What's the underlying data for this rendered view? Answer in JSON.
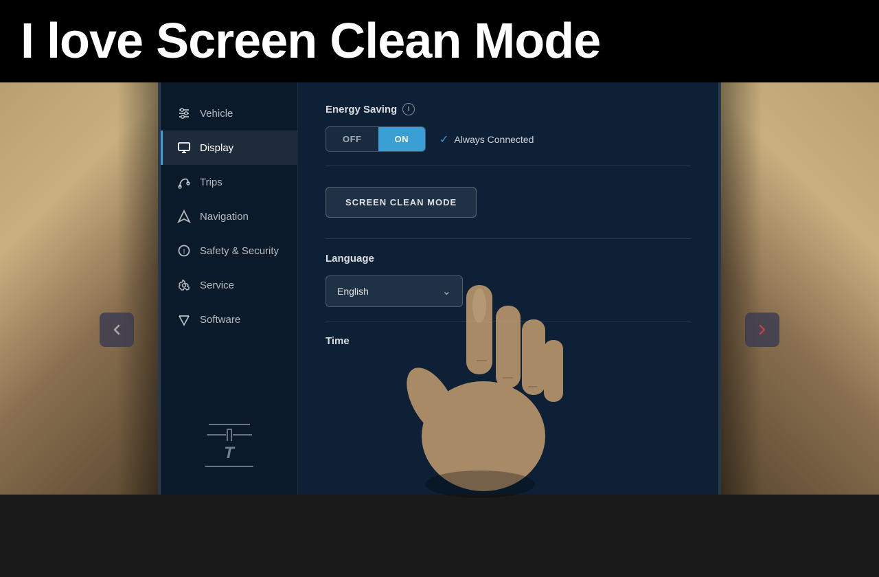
{
  "top_bar": {
    "title": "I love Screen Clean Mode"
  },
  "sidebar": {
    "items": [
      {
        "id": "vehicle",
        "label": "Vehicle",
        "icon": "sliders-icon",
        "active": false
      },
      {
        "id": "display",
        "label": "Display",
        "icon": "display-icon",
        "active": true
      },
      {
        "id": "trips",
        "label": "Trips",
        "icon": "trips-icon",
        "active": false
      },
      {
        "id": "navigation",
        "label": "Navigation",
        "icon": "navigation-icon",
        "active": false
      },
      {
        "id": "safety-security",
        "label": "Safety & Security",
        "icon": "safety-icon",
        "active": false
      },
      {
        "id": "service",
        "label": "Service",
        "icon": "service-icon",
        "active": false
      },
      {
        "id": "software",
        "label": "Software",
        "icon": "software-icon",
        "active": false
      }
    ]
  },
  "energy_saving": {
    "label": "Energy Saving",
    "info_icon": "i",
    "off_label": "OFF",
    "on_label": "ON",
    "active": "on",
    "always_connected_label": "Always Connected"
  },
  "screen_clean_mode": {
    "button_label": "SCREEN CLEAN MODE"
  },
  "language": {
    "label": "Language",
    "selected": "English"
  },
  "time": {
    "label": "Time"
  },
  "colors": {
    "accent": "#3a9fd5",
    "bg_screen": "#0d2035",
    "bg_sidebar": "#0a1a2a"
  }
}
